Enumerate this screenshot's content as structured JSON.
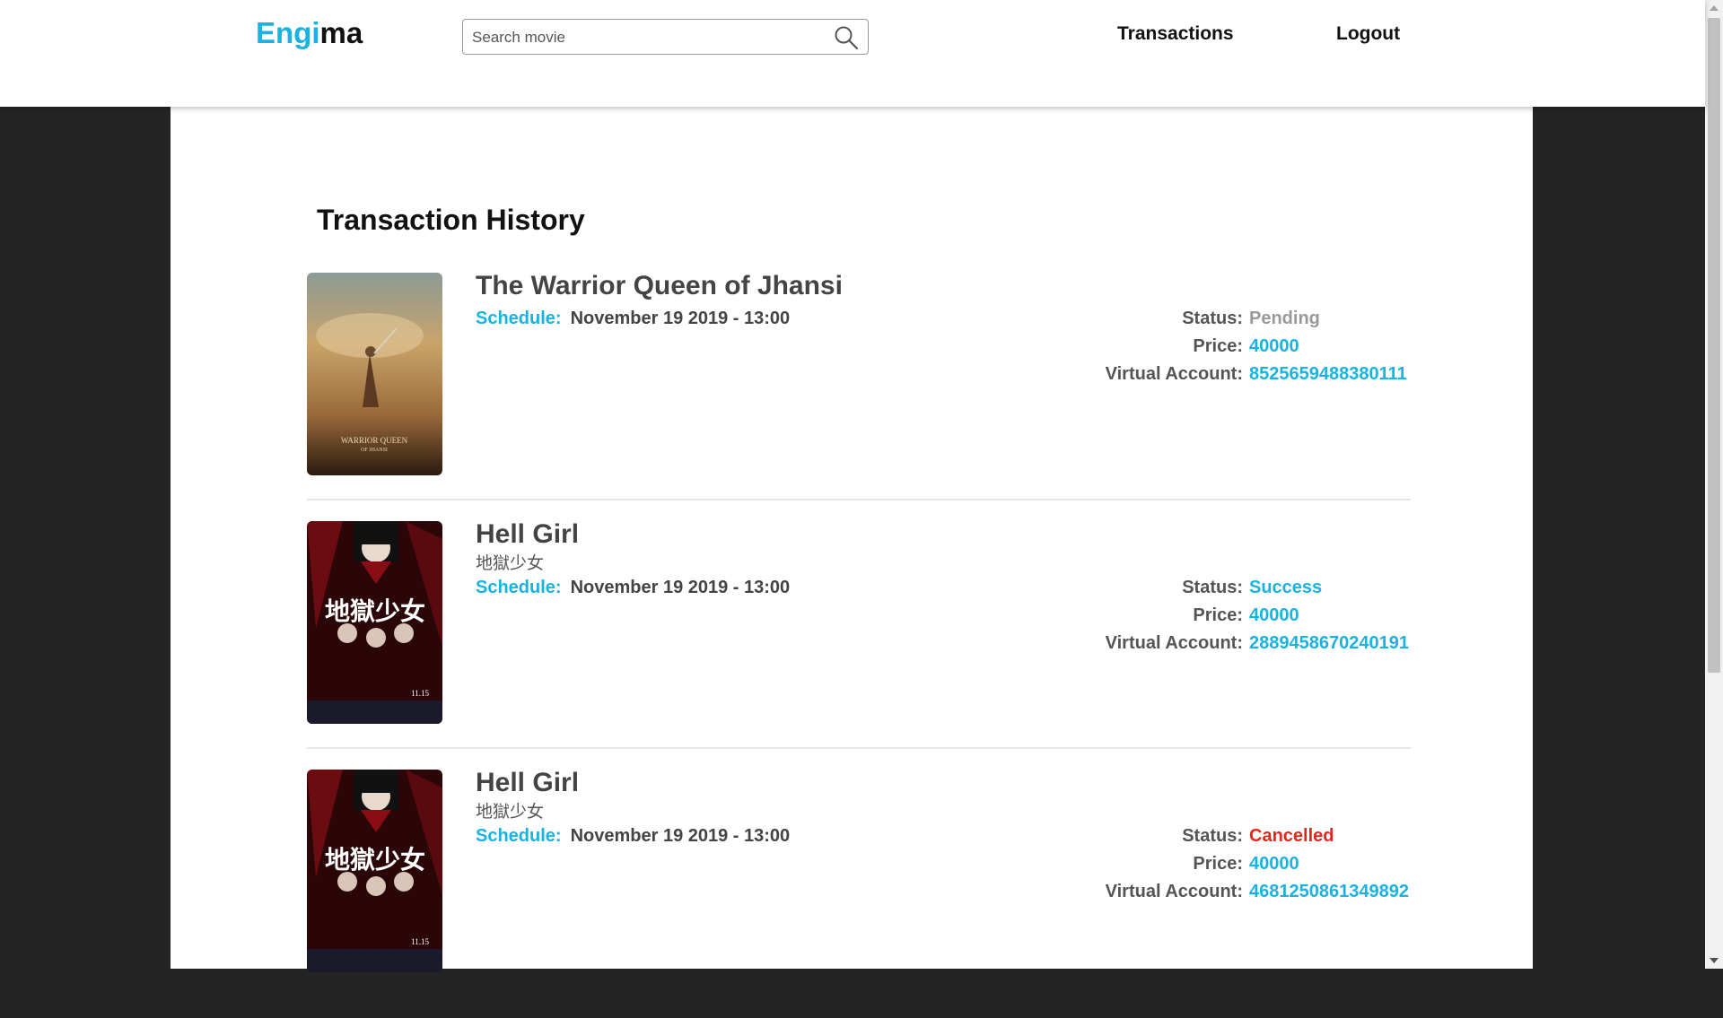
{
  "header": {
    "logo_part1": "Engi",
    "logo_part2": "ma",
    "search_placeholder": "Search movie",
    "nav": [
      {
        "label": "Transactions"
      },
      {
        "label": "Logout"
      }
    ]
  },
  "page": {
    "title": "Transaction History"
  },
  "colors": {
    "accent": "#1ab2e0",
    "pending": "#999999",
    "cancelled": "#e0281f",
    "background": "#242424"
  },
  "labels": {
    "schedule": "Schedule:",
    "status": "Status:",
    "price": "Price:",
    "virtual_account": "Virtual Account:"
  },
  "transactions": [
    {
      "title": "The Warrior Queen of Jhansi",
      "subtitle": "",
      "schedule": "November 19 2019 - 13:00",
      "status": "Pending",
      "price": "40000",
      "virtual_account": "8525659488380111",
      "poster_text_1": "WARRIOR QUEEN",
      "poster_text_2": "OF JHANSI"
    },
    {
      "title": "Hell Girl",
      "subtitle": "地獄少女",
      "schedule": "November 19 2019 - 13:00",
      "status": "Success",
      "price": "40000",
      "virtual_account": "2889458670240191",
      "poster_text_1": "地獄少女",
      "poster_text_2": "11.15"
    },
    {
      "title": "Hell Girl",
      "subtitle": "地獄少女",
      "schedule": "November 19 2019 - 13:00",
      "status": "Cancelled",
      "price": "40000",
      "virtual_account": "4681250861349892",
      "poster_text_1": "地獄少女",
      "poster_text_2": "11.15"
    }
  ]
}
